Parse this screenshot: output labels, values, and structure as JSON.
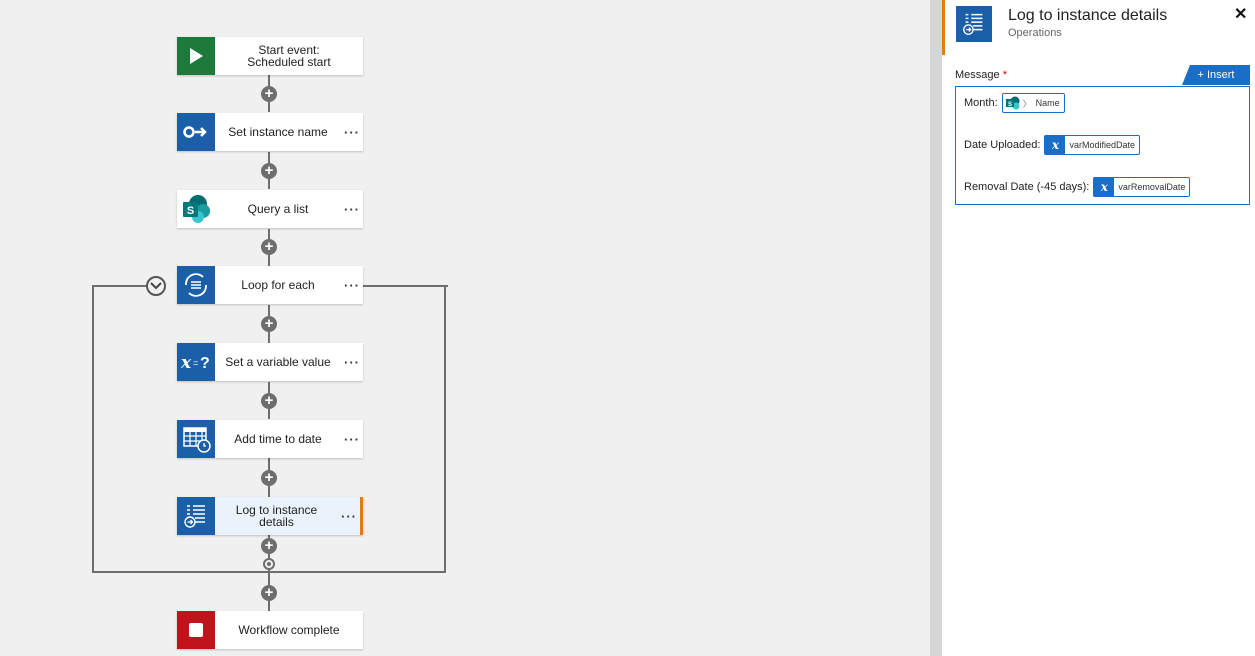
{
  "workflow": {
    "nodes": [
      {
        "id": "start",
        "label": "Start event: Scheduled start",
        "more": ""
      },
      {
        "id": "set-instance-name",
        "label": "Set instance name",
        "more": "···"
      },
      {
        "id": "query-list",
        "label": "Query a list",
        "more": "···"
      },
      {
        "id": "loop-for-each",
        "label": "Loop for each",
        "more": "···"
      },
      {
        "id": "set-variable",
        "label": "Set a variable value",
        "more": "···"
      },
      {
        "id": "add-time",
        "label": "Add time to date",
        "more": "···"
      },
      {
        "id": "log-instance",
        "label": "Log to instance details",
        "more": "···"
      },
      {
        "id": "workflow-complete",
        "label": "Workflow complete",
        "more": ""
      }
    ],
    "start_label_1": "Start event:",
    "start_label_2": "Scheduled start",
    "log_label_1": "Log to instance",
    "log_label_2": "details"
  },
  "panel": {
    "title": "Log to instance details",
    "subtitle": "Operations",
    "close": "✕",
    "message_label": "Message",
    "required_mark": "*",
    "insert_label": "+ Insert",
    "lines": [
      {
        "prefix": "Month:",
        "token": "Name",
        "token_icon": "sharepoint-icon"
      },
      {
        "prefix": "Date Uploaded:",
        "token": "varModifiedDate",
        "token_icon": "variable-icon"
      },
      {
        "prefix": "Removal Date (-45 days):",
        "token": "varRemovalDate",
        "token_icon": "variable-icon"
      }
    ]
  },
  "colors": {
    "accent_orange": "#e07b1a",
    "action_blue": "#1a5fa8",
    "start_green": "#1e7a3a",
    "stop_red": "#c0141c",
    "sharepoint_teal": "#0b7a75"
  }
}
